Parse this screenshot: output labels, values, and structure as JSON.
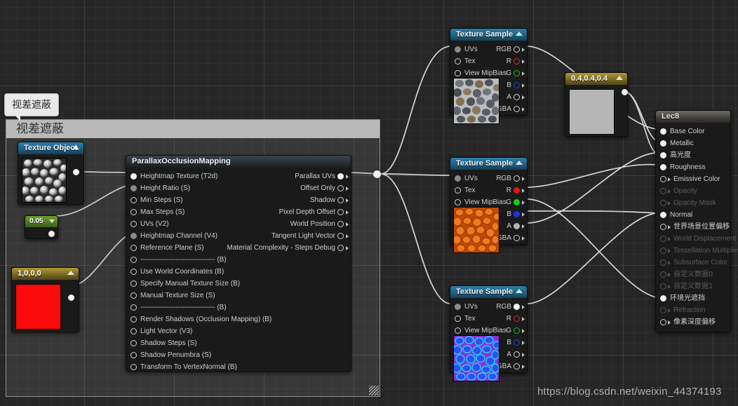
{
  "app": {
    "watermark": "https://blog.csdn.net/weixin_44374193"
  },
  "bubble": {
    "text": "视差遮蔽"
  },
  "comment": {
    "title": "视差遮蔽"
  },
  "nodes": {
    "texture_object": {
      "title": "Texture Object",
      "output_pin": "texture-object-output"
    },
    "const_scalar": {
      "value": "0.05"
    },
    "const_vector_red": {
      "value": "1,0,0,0",
      "color": "#fb0b0b"
    },
    "const_vector_grey": {
      "value": "0.4,0.4,0.4",
      "color": "#b6b6b6"
    },
    "parallax": {
      "title": "ParallaxOcclusionMapping",
      "inputs": [
        "Heightmap Texture (T2d)",
        "Height Ratio (S)",
        "Min Steps (S)",
        "Max Steps (S)",
        "UVs (V2)",
        "Heightmap Channel (V4)",
        "Reference Plane (S)",
        "-------------------------------- (B)",
        "Use World Coordinates (B)",
        "Specify Manual Texture Size (B)",
        "Manual Texture Size (S)",
        "-------------------------------- (B)",
        "Render Shadows (Occlusion Mapping) (B)",
        "Light Vector (V3)",
        "Shadow Steps (S)",
        "Shadow Penumbra (S)",
        "Transform To VertexNormal (B)"
      ],
      "outputs": [
        "Parallax UVs",
        "Offset Only",
        "Shadow",
        "Pixel Depth Offset",
        "World Position",
        "Tangent Light Vector",
        "Material Complexity - Steps Debug"
      ]
    },
    "texture_sample_top": {
      "title": "Texture Sample",
      "inputs": [
        "UVs",
        "Tex",
        "View MipBias"
      ],
      "outputs": [
        "RGB",
        "R",
        "G",
        "B",
        "A",
        "RGBA"
      ]
    },
    "texture_sample_mid": {
      "title": "Texture Sample",
      "inputs": [
        "UVs",
        "Tex",
        "View MipBias"
      ],
      "outputs": [
        "RGB",
        "R",
        "G",
        "B",
        "A",
        "RGBA"
      ]
    },
    "texture_sample_bottom": {
      "title": "Texture Sample",
      "inputs": [
        "UVs",
        "Tex",
        "View MipBias"
      ],
      "outputs": [
        "RGB",
        "R",
        "G",
        "B",
        "A",
        "RGBA"
      ]
    },
    "material": {
      "title": "Lec8",
      "inputs": [
        "Base Color",
        "Metallic",
        "高光度",
        "Roughness",
        "Emissive Color",
        "Opacity",
        "Opacity Mask",
        "Normal",
        "世界场景位置偏移",
        "World Displacement",
        "Tessellation Multiplier",
        "Subsurface Color",
        "自定义数据0",
        "自定义数据1",
        "环境光遮挡",
        "Refraction",
        "像素深度偏移"
      ]
    }
  }
}
